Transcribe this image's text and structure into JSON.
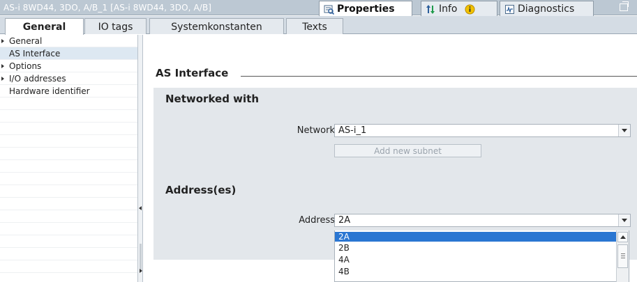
{
  "titlebar": {
    "title": "AS-i 8WD44, 3DO, A/B_1 [AS-i 8WD44, 3DO, A/B]",
    "tabs": [
      {
        "label": "Properties",
        "icon": "properties-icon",
        "active": true
      },
      {
        "label": "Info",
        "icon": "info-icon",
        "badge_icon": "info-badge-icon",
        "active": false
      },
      {
        "label": "Diagnostics",
        "icon": "diagnostics-icon",
        "active": false
      }
    ]
  },
  "subtabs": [
    {
      "label": "General",
      "active": true
    },
    {
      "label": "IO tags",
      "active": false
    },
    {
      "label": "Systemkonstanten",
      "active": false
    },
    {
      "label": "Texts",
      "active": false
    }
  ],
  "nav": {
    "items": [
      {
        "label": "General",
        "expandable": true,
        "selected": false
      },
      {
        "label": "AS Interface",
        "expandable": false,
        "selected": true
      },
      {
        "label": "Options",
        "expandable": true,
        "selected": false
      },
      {
        "label": "I/O addresses",
        "expandable": true,
        "selected": false
      },
      {
        "label": "Hardware identifier",
        "expandable": false,
        "selected": false
      }
    ]
  },
  "content": {
    "section_title": "AS Interface",
    "networked": {
      "title": "Networked with",
      "network_label": "Network",
      "network_value": "AS-i_1",
      "add_subnet_label": "Add new subnet"
    },
    "address": {
      "title": "Address(es)",
      "address_label": "Address",
      "address_value": "2A",
      "options": [
        "2A",
        "2B",
        "4A",
        "4B"
      ],
      "selected_option": "2A"
    }
  },
  "colors": {
    "titlebar_bg": "#bcc8d3",
    "panel_bg": "#e3e7eb",
    "selection": "#2a76d2",
    "nav_selected": "#dde8f2"
  }
}
